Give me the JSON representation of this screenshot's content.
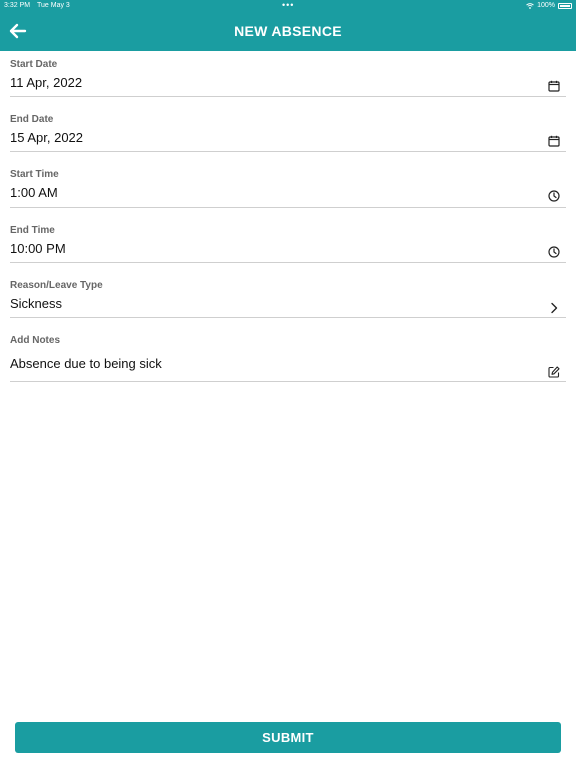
{
  "status_bar": {
    "time": "3:32 PM",
    "date": "Tue May 3",
    "battery": "100%"
  },
  "header": {
    "title": "NEW ABSENCE",
    "back_icon": "arrow-left-icon"
  },
  "form": {
    "start_date": {
      "label": "Start Date",
      "value": "11 Apr, 2022",
      "icon": "calendar-icon"
    },
    "end_date": {
      "label": "End Date",
      "value": "15 Apr, 2022",
      "icon": "calendar-icon"
    },
    "start_time": {
      "label": "Start Time",
      "value": "1:00 AM",
      "icon": "clock-icon"
    },
    "end_time": {
      "label": "End Time",
      "value": "10:00 PM",
      "icon": "clock-icon"
    },
    "reason": {
      "label": "Reason/Leave Type",
      "value": "Sickness",
      "icon": "chevron-right-icon"
    },
    "notes": {
      "label": "Add Notes",
      "value": "Absence due to being sick",
      "icon": "edit-icon"
    }
  },
  "submit_label": "SUBMIT",
  "colors": {
    "accent": "#1a9da1",
    "divider": "#cfcfcf",
    "label": "#666666"
  }
}
